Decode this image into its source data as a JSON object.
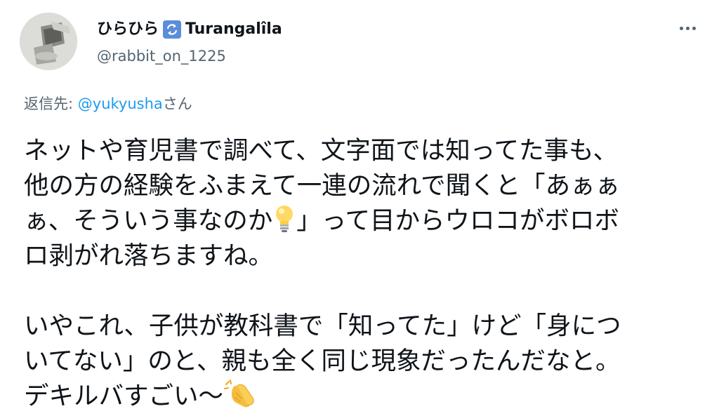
{
  "tweet": {
    "display_name": "ひらひら",
    "display_name_suffix": "Turangalîla",
    "handle": "@rabbit_on_1225",
    "reply_prefix": "返信先: ",
    "reply_mention": "@yukyusha",
    "reply_suffix": "さん",
    "paragraph1_a": "ネットや育児書で調べて、文字面では知ってた事も、\n他の方の経験をふまえて一連の流れで聞くと「あぁぁ\nぁ、そういう事なのか",
    "paragraph1_b": "」って目からウロコがボロボ\nロ剥がれ落ちますね。\n\nいやこれ、子供が教科書で「知ってた」けど「身につ\nいてない」のと、親も全く同じ現象だったんだなと。\nデキルバすごい〜",
    "icons": [
      "repeat-icon",
      "more-icon",
      "light-bulb-icon",
      "clapping-hands-icon"
    ]
  }
}
